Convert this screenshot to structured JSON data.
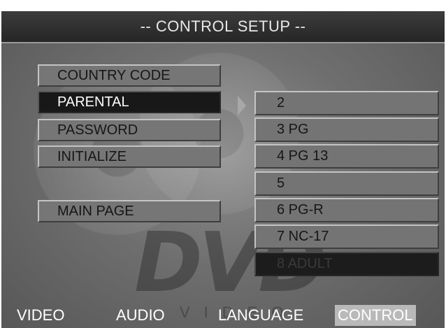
{
  "title": "-- CONTROL SETUP --",
  "menu": [
    {
      "label": "COUNTRY CODE",
      "selected": false
    },
    {
      "label": "PARENTAL",
      "selected": true
    },
    {
      "label": "PASSWORD",
      "selected": false
    },
    {
      "label": "INITIALIZE",
      "selected": false
    },
    {
      "label": "MAIN PAGE",
      "selected": false
    }
  ],
  "options": [
    {
      "label": "2",
      "selected": false
    },
    {
      "label": "3 PG",
      "selected": false
    },
    {
      "label": "4 PG 13",
      "selected": false
    },
    {
      "label": "5",
      "selected": false
    },
    {
      "label": "6 PG-R",
      "selected": false
    },
    {
      "label": "7 NC-17",
      "selected": false
    },
    {
      "label": "8 ADULT",
      "selected": true
    }
  ],
  "tabs": [
    {
      "label": "VIDEO",
      "active": false
    },
    {
      "label": "AUDIO",
      "active": false
    },
    {
      "label": "LANGUAGE",
      "active": false
    },
    {
      "label": "CONTROL",
      "active": true
    }
  ],
  "watermark": {
    "logo": "DVD",
    "sub": "VIDEO"
  },
  "icons": {
    "pointer": "right-triangle-icon"
  },
  "colors": {
    "panel": "#6f6f6f",
    "title_bar": "#2e2e2e",
    "selected": "#181818",
    "active_tab": "#b9b9b9"
  }
}
